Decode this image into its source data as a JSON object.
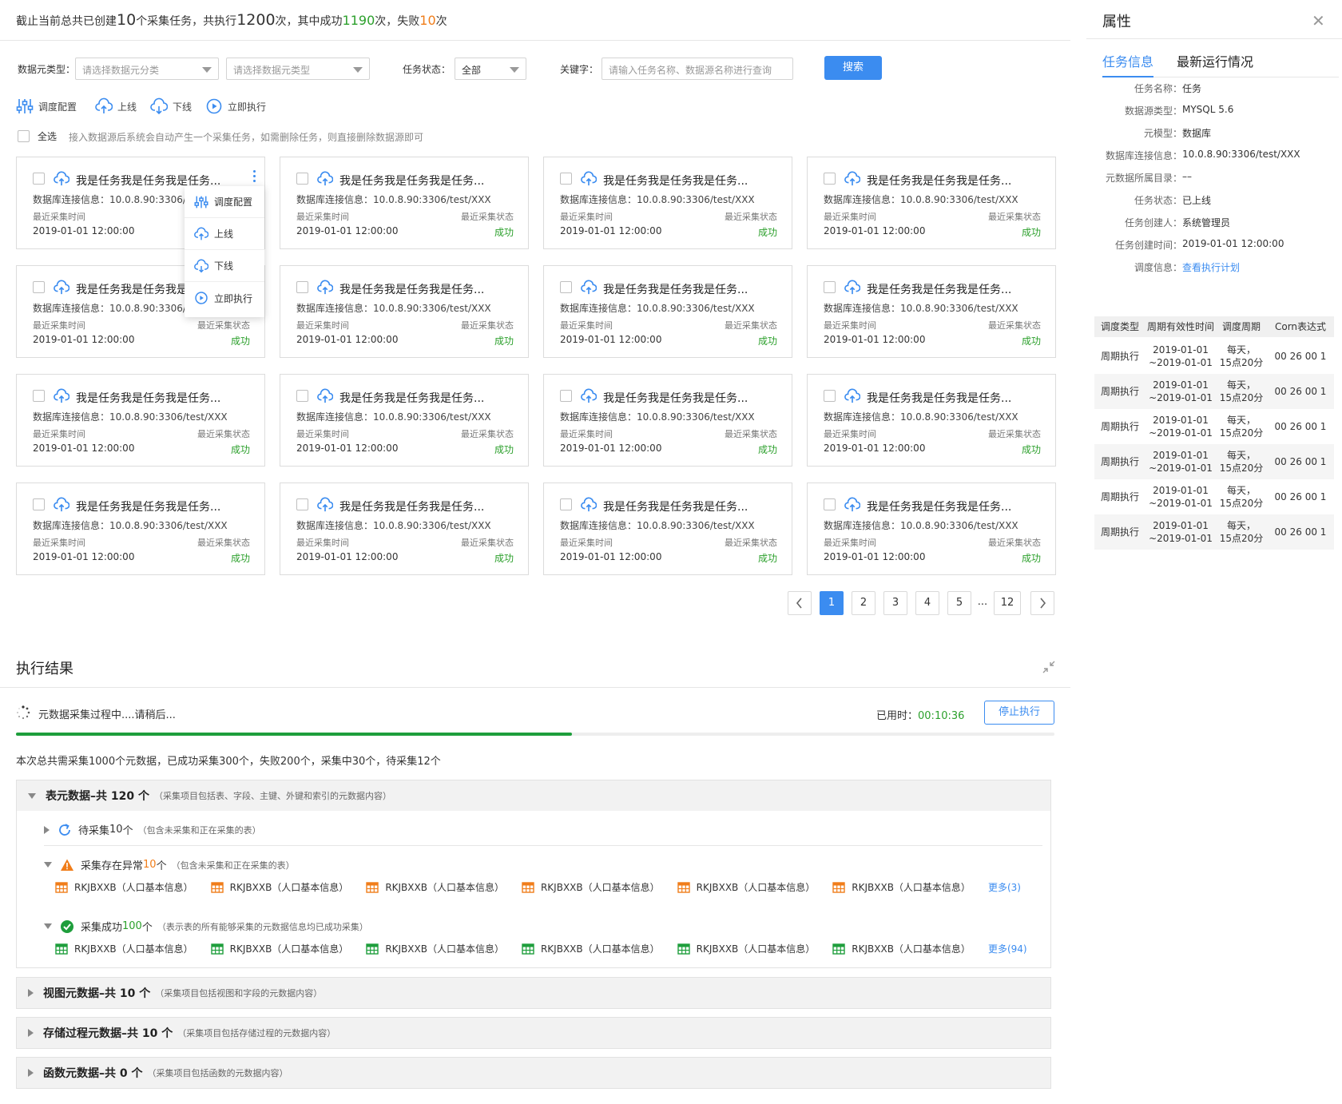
{
  "summary": {
    "p1": "截止当前总共已创建",
    "task_count": "10",
    "p2": "个采集任务，共执行",
    "exec_count": "1200",
    "p3": "次，其中成功",
    "success_count": "1190",
    "p4": "次，失败",
    "fail_count": "10",
    "p5": "次"
  },
  "filters": {
    "meta_type_label": "数据元类型：",
    "meta_category_placeholder": "请选择数据元分类",
    "meta_type_placeholder": "请选择数据元类型",
    "status_label": "任务状态：",
    "status_value": "全部",
    "keyword_label": "关键字：",
    "keyword_placeholder": "请输入任务名称、数据源名称进行查询",
    "search_button": "搜索"
  },
  "toolbar": {
    "schedule": "调度配置",
    "online": "上线",
    "offline": "下线",
    "execute": "立即执行"
  },
  "select_all": "全选",
  "select_hint": "接入数据源后系统会自动产生一个采集任务，如需删除任务，则直接删除数据源即可",
  "card": {
    "title": "我是任务我是任务我是任务...",
    "conn_label": "数据库连接信息：",
    "conn_value": "10.0.8.90:3306/test/XXX",
    "time_label": "最近采集时间",
    "status_label": "最近采集状态",
    "time_value": "2019-01-01 12:00:00",
    "status_value": "成功"
  },
  "popup_menu": [
    "调度配置",
    "上线",
    "下线",
    "立即执行"
  ],
  "pagination": {
    "pages": [
      "1",
      "2",
      "3",
      "4",
      "5"
    ],
    "ellipsis": "...",
    "last": "12",
    "current": "1"
  },
  "results": {
    "title": "执行结果",
    "progress_text": "元数据采集过程中....请稍后...",
    "elapsed_label": "已用时：",
    "elapsed_value": "00:10:36",
    "stop_button": "停止执行",
    "progress": 0.535,
    "stat_text": "本次总共需采集1000个元数据，已成功采集300个，失败200个，采集中30个，待采集12个"
  },
  "groups": [
    {
      "title": "表元数据–共 120 个",
      "note": "（采集项目包括表、字段、主键、外键和索引的元数据内容）"
    },
    {
      "title": "视图元数据–共 10 个",
      "note": "（采集项目包括视图和字段的元数据内容）"
    },
    {
      "title": "存储过程元数据–共 10 个",
      "note": "（采集项目包括存储过程的元数据内容）"
    },
    {
      "title": "函数元数据–共 0 个",
      "note": "（采集项目包括函数的元数据内容）"
    }
  ],
  "table_group": {
    "pending": {
      "label": "待采集 ",
      "count": "10",
      "unit": "个",
      "note": "（包含未采集和正在采集的表）"
    },
    "error": {
      "label": "采集存在异常 ",
      "count": "10",
      "unit": "个",
      "note": "（包含未采集和正在采集的表）",
      "more": "更多(3)"
    },
    "success": {
      "label": "采集成功 ",
      "count": "100",
      "unit": "个",
      "note": "（表示表的所有能够采集的元数据信息均已成功采集）",
      "more": "更多(94)"
    },
    "item": "RKJBXXB（人口基本信息）"
  },
  "side": {
    "title": "属性",
    "tabs": [
      "任务信息",
      "最新运行情况"
    ],
    "props": [
      {
        "k": "任务名称：",
        "v": "任务"
      },
      {
        "k": "数据源类型：",
        "v": "MYSQL 5.6"
      },
      {
        "k": "元模型：",
        "v": "数据库"
      },
      {
        "k": "数据库连接信息：",
        "v": "10.0.8.90:3306/test/XXX"
      },
      {
        "k": "元数据所属目录：",
        "v": "––"
      },
      {
        "k": "任务状态：",
        "v": "已上线"
      },
      {
        "k": "任务创建人：",
        "v": "系统管理员"
      },
      {
        "k": "任务创建时间：",
        "v": "2019-01-01 12:00:00"
      },
      {
        "k": "调度信息：",
        "v": "查看执行计划"
      }
    ],
    "table_headers": [
      "调度类型",
      "周期有效性时间",
      "调度周期",
      "Corn表达式"
    ],
    "table_row": {
      "type": "周期执行",
      "period_1": "2019-01-01",
      "period_2": "~2019-01-01",
      "cycle_1": "每天，",
      "cycle_2": "15点20分",
      "cron": "00 26 00 1"
    }
  },
  "colors": {
    "accent": "#3b8cf0",
    "success": "#2ca02c",
    "warning": "#f07d1a"
  }
}
